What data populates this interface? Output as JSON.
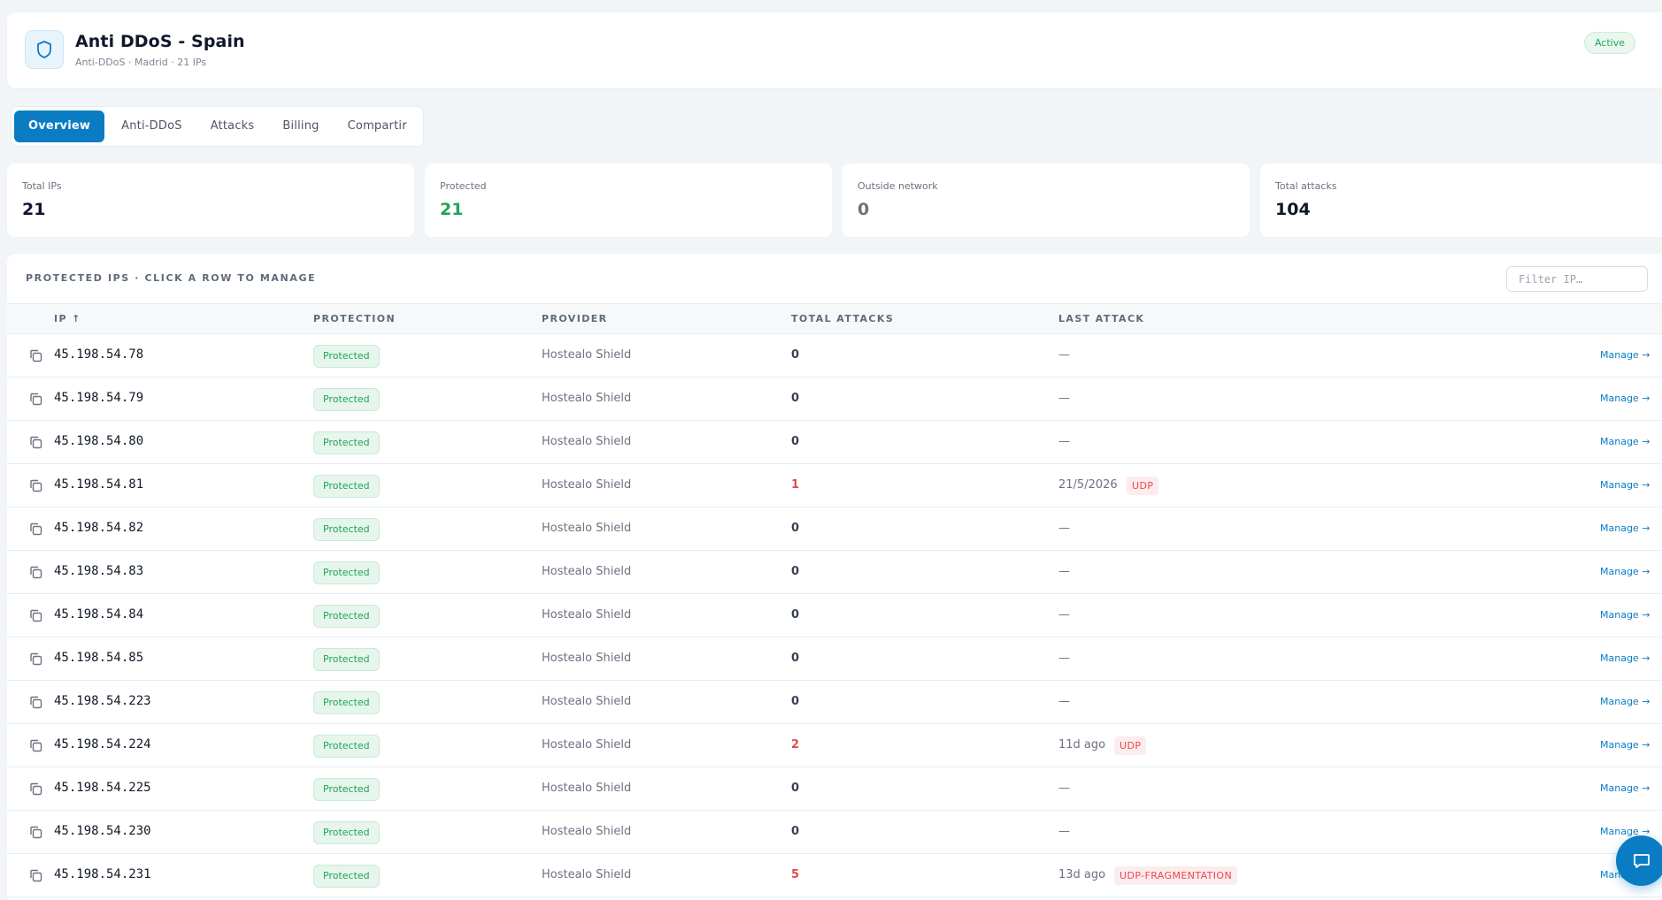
{
  "header": {
    "title": "Anti DDoS - Spain",
    "subtitle": "Anti-DDoS · Madrid · 21 IPs",
    "status": "Active",
    "icon": "shield-icon"
  },
  "tabs": [
    {
      "label": "Overview",
      "active": true
    },
    {
      "label": "Anti-DDoS",
      "active": false
    },
    {
      "label": "Attacks",
      "active": false
    },
    {
      "label": "Billing",
      "active": false
    },
    {
      "label": "Compartir",
      "active": false
    }
  ],
  "stats": [
    {
      "label": "Total IPs",
      "value": "21"
    },
    {
      "label": "Protected",
      "value": "21"
    },
    {
      "label": "Outside network",
      "value": "0"
    },
    {
      "label": "Total attacks",
      "value": "104"
    }
  ],
  "table": {
    "title": "PROTECTED IPS · CLICK A ROW TO MANAGE",
    "filter_placeholder": "Filter IP…",
    "columns": {
      "ip": "IP ↑",
      "protection": "PROTECTION",
      "provider": "PROVIDER",
      "total_attacks": "TOTAL ATTACKS",
      "last_attack": "LAST ATTACK"
    },
    "manage_label": "Manage →",
    "rows": [
      {
        "ip": "45.198.54.78",
        "protection": "Protected",
        "provider": "Hostealo Shield",
        "attacks": "0",
        "last": "—",
        "type": ""
      },
      {
        "ip": "45.198.54.79",
        "protection": "Protected",
        "provider": "Hostealo Shield",
        "attacks": "0",
        "last": "—",
        "type": ""
      },
      {
        "ip": "45.198.54.80",
        "protection": "Protected",
        "provider": "Hostealo Shield",
        "attacks": "0",
        "last": "—",
        "type": ""
      },
      {
        "ip": "45.198.54.81",
        "protection": "Protected",
        "provider": "Hostealo Shield",
        "attacks": "1",
        "last": "21/5/2026",
        "type": "UDP"
      },
      {
        "ip": "45.198.54.82",
        "protection": "Protected",
        "provider": "Hostealo Shield",
        "attacks": "0",
        "last": "—",
        "type": ""
      },
      {
        "ip": "45.198.54.83",
        "protection": "Protected",
        "provider": "Hostealo Shield",
        "attacks": "0",
        "last": "—",
        "type": ""
      },
      {
        "ip": "45.198.54.84",
        "protection": "Protected",
        "provider": "Hostealo Shield",
        "attacks": "0",
        "last": "—",
        "type": ""
      },
      {
        "ip": "45.198.54.85",
        "protection": "Protected",
        "provider": "Hostealo Shield",
        "attacks": "0",
        "last": "—",
        "type": ""
      },
      {
        "ip": "45.198.54.223",
        "protection": "Protected",
        "provider": "Hostealo Shield",
        "attacks": "0",
        "last": "—",
        "type": ""
      },
      {
        "ip": "45.198.54.224",
        "protection": "Protected",
        "provider": "Hostealo Shield",
        "attacks": "2",
        "last": "11d ago",
        "type": "UDP"
      },
      {
        "ip": "45.198.54.225",
        "protection": "Protected",
        "provider": "Hostealo Shield",
        "attacks": "0",
        "last": "—",
        "type": ""
      },
      {
        "ip": "45.198.54.230",
        "protection": "Protected",
        "provider": "Hostealo Shield",
        "attacks": "0",
        "last": "—",
        "type": ""
      },
      {
        "ip": "45.198.54.231",
        "protection": "Protected",
        "provider": "Hostealo Shield",
        "attacks": "5",
        "last": "13d ago",
        "type": "UDP-FRAGMENTATION"
      }
    ]
  },
  "colors": {
    "accent": "#0a7cc4",
    "success": "#22a35a",
    "danger": "#e5484d",
    "background": "#f1f5f8"
  },
  "chat": {
    "icon": "chat-icon"
  }
}
